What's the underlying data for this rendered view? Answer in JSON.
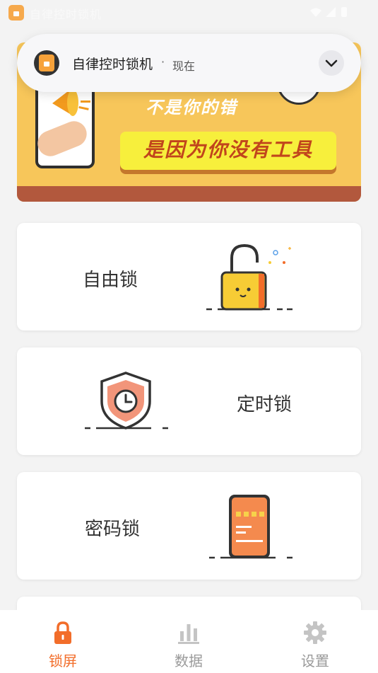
{
  "status_bar": {
    "app_text": "自律控时锁机"
  },
  "notification": {
    "app_name": "自律控时锁机",
    "separator": "·",
    "time": "现在",
    "icon": "lock-app-icon",
    "expand_icon": "chevron-down-icon"
  },
  "banner": {
    "line1": "不是你的错",
    "line2": "是因为你没有工具"
  },
  "cards": [
    {
      "label": "自由锁",
      "icon": "unlocked-padlock-icon"
    },
    {
      "label": "定时锁",
      "icon": "shield-clock-icon"
    },
    {
      "label": "密码锁",
      "icon": "phone-password-icon"
    }
  ],
  "bottom_nav": [
    {
      "label": "锁屏",
      "icon": "lock-icon",
      "active": true
    },
    {
      "label": "数据",
      "icon": "bar-chart-icon",
      "active": false
    },
    {
      "label": "设置",
      "icon": "gear-icon",
      "active": false
    }
  ],
  "colors": {
    "accent": "#f26d2a",
    "banner_bg": "#f7c65a",
    "banner_stripe": "#b2583d",
    "slogan_box": "#f7ef3c",
    "inactive": "#9a9a9a"
  }
}
